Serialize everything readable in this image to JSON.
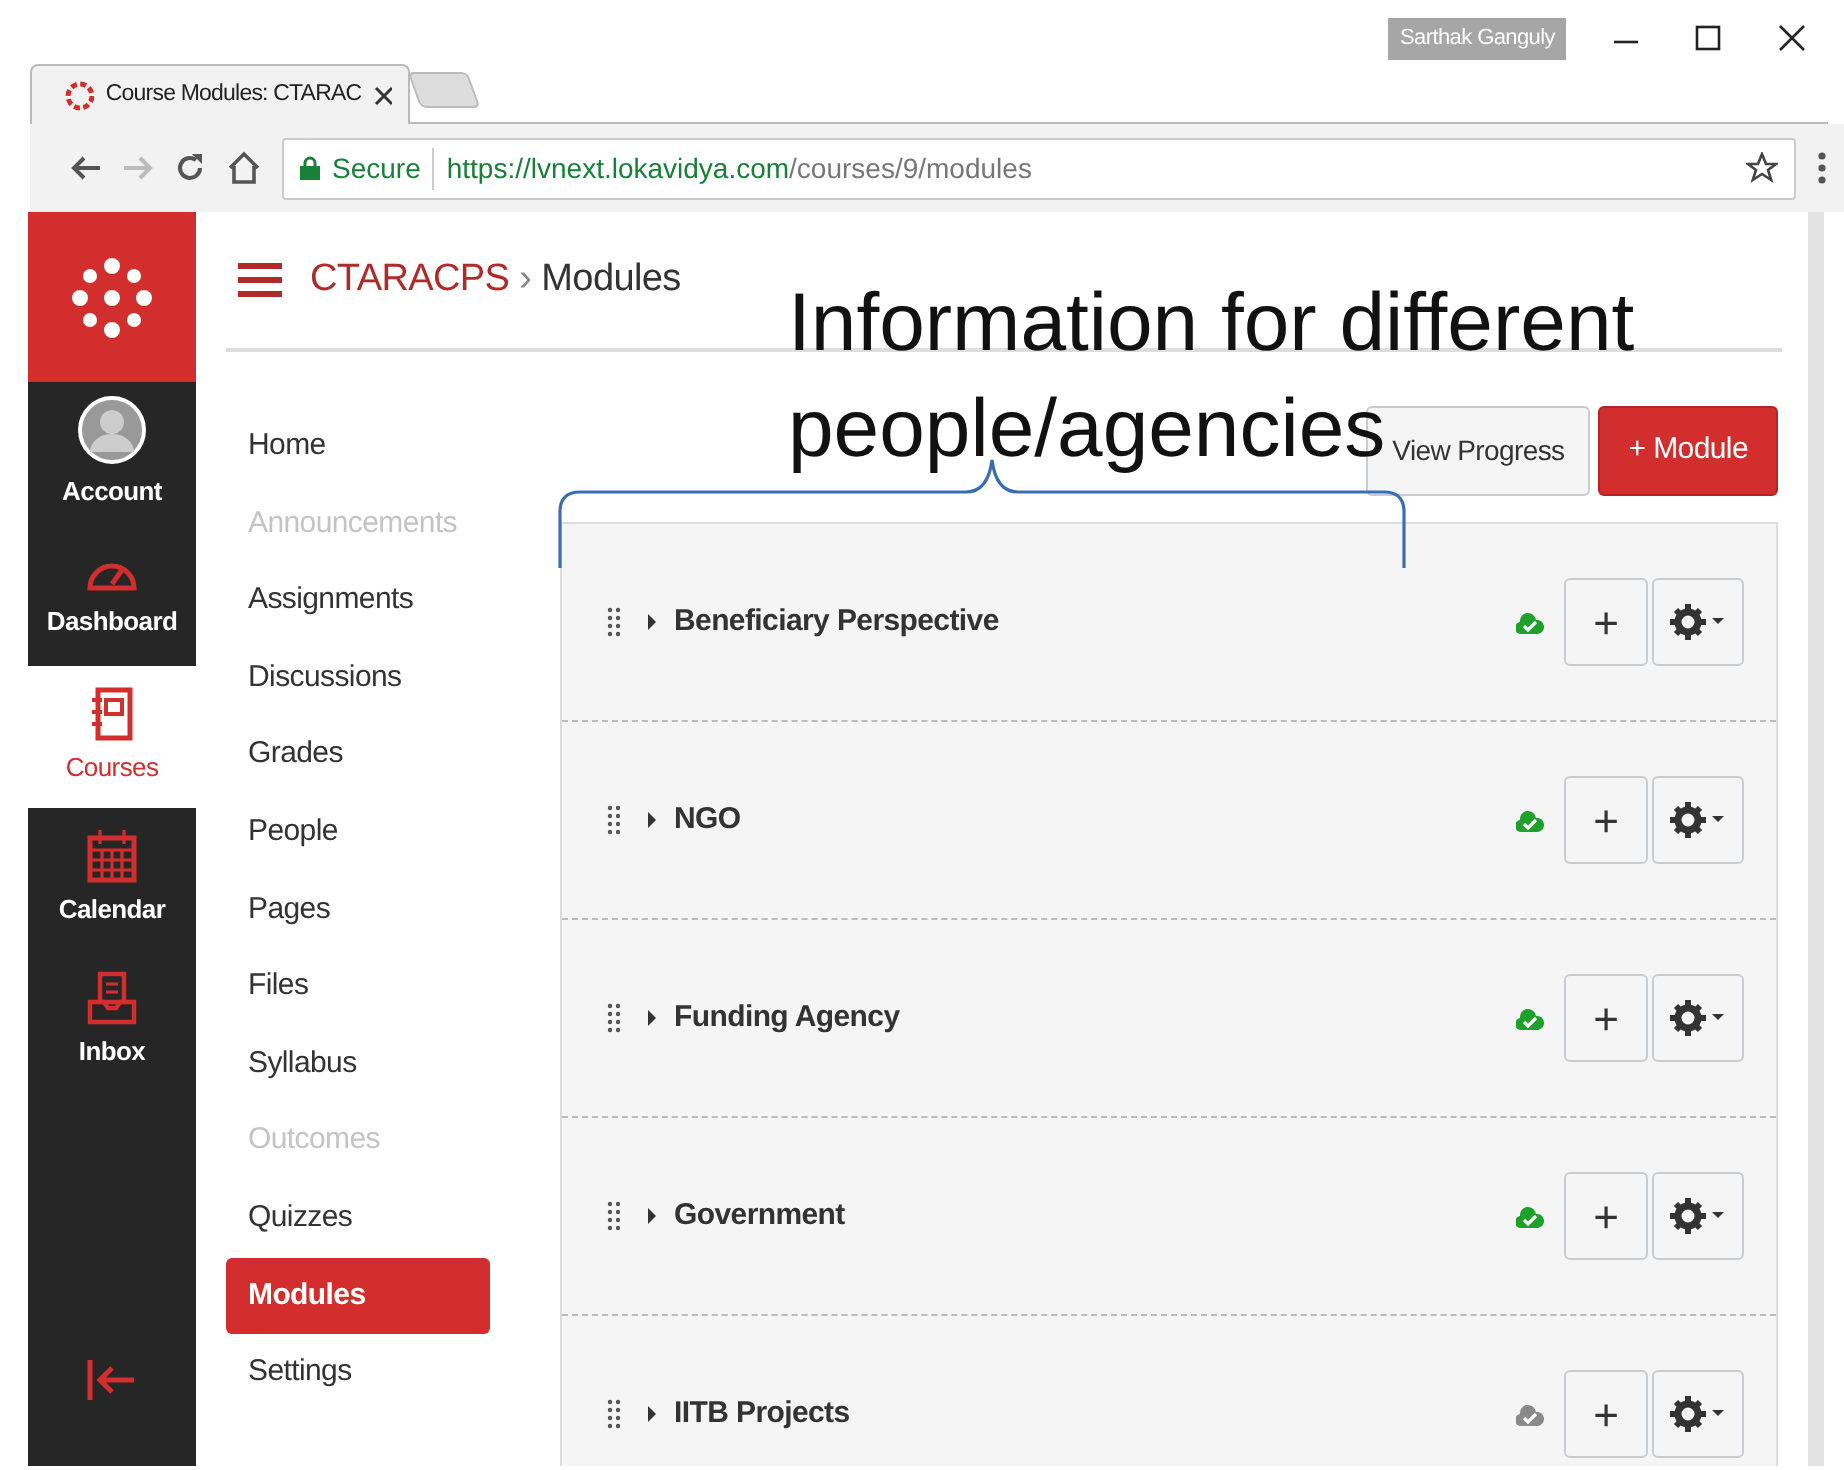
{
  "browser": {
    "user": "Sarthak Ganguly",
    "tab_title": "Course Modules: CTARAC",
    "secure_label": "Secure",
    "url_host": "https://lvnext.lokavidya.com",
    "url_path": "/courses/9/modules"
  },
  "global_nav": [
    {
      "label": "Account",
      "kind": "account",
      "selected": false
    },
    {
      "label": "Dashboard",
      "kind": "dashboard",
      "selected": false
    },
    {
      "label": "Courses",
      "kind": "courses",
      "selected": true
    },
    {
      "label": "Calendar",
      "kind": "calendar",
      "selected": false
    },
    {
      "label": "Inbox",
      "kind": "inbox",
      "selected": false
    }
  ],
  "breadcrumb": {
    "course": "CTARACPS",
    "separator": "›",
    "page": "Modules"
  },
  "course_nav": [
    {
      "label": "Home",
      "disabled": false,
      "selected": false
    },
    {
      "label": "Announcements",
      "disabled": true,
      "selected": false
    },
    {
      "label": "Assignments",
      "disabled": false,
      "selected": false
    },
    {
      "label": "Discussions",
      "disabled": false,
      "selected": false
    },
    {
      "label": "Grades",
      "disabled": false,
      "selected": false
    },
    {
      "label": "People",
      "disabled": false,
      "selected": false
    },
    {
      "label": "Pages",
      "disabled": false,
      "selected": false
    },
    {
      "label": "Files",
      "disabled": false,
      "selected": false
    },
    {
      "label": "Syllabus",
      "disabled": false,
      "selected": false
    },
    {
      "label": "Outcomes",
      "disabled": true,
      "selected": false
    },
    {
      "label": "Quizzes",
      "disabled": false,
      "selected": false
    },
    {
      "label": "Modules",
      "disabled": false,
      "selected": true
    },
    {
      "label": "Settings",
      "disabled": false,
      "selected": false
    }
  ],
  "actions": {
    "view_progress": "View Progress",
    "add_module": "+ Module"
  },
  "modules": [
    {
      "title": "Beneficiary Perspective",
      "published": true,
      "add": "+"
    },
    {
      "title": "NGO",
      "published": true,
      "add": "+"
    },
    {
      "title": "Funding Agency",
      "published": true,
      "add": "+"
    },
    {
      "title": "Government",
      "published": true,
      "add": "+"
    },
    {
      "title": "IITB Projects",
      "published": false,
      "add": "+"
    }
  ],
  "annotation": {
    "lines": [
      "Information for different",
      "people/agencies"
    ]
  }
}
